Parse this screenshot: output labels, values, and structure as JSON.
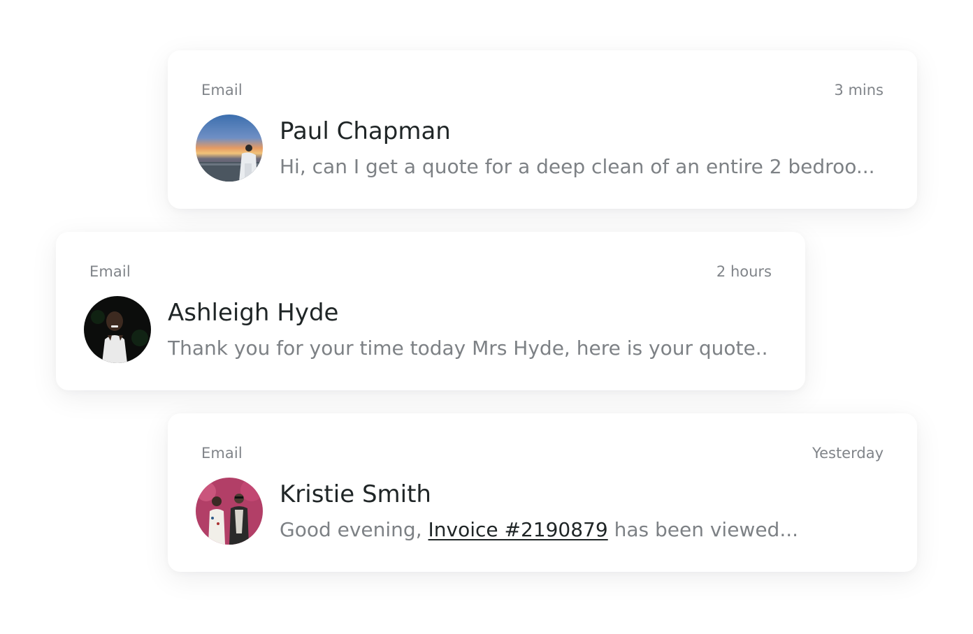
{
  "notifications": [
    {
      "channel": "Email",
      "time": "3 mins",
      "name": "Paul Chapman",
      "preview": "Hi, can I get a quote for a deep clean of an entire 2 bedroo..."
    },
    {
      "channel": "Email",
      "time": "2 hours",
      "name": "Ashleigh Hyde",
      "preview": "Thank you for your time today Mrs Hyde, here is your quote..."
    },
    {
      "channel": "Email",
      "time": "Yesterday",
      "name": "Kristie Smith",
      "preview_prefix": "Good evening, ",
      "preview_link": "Invoice #2190879",
      "preview_suffix": " has been viewed..."
    }
  ]
}
